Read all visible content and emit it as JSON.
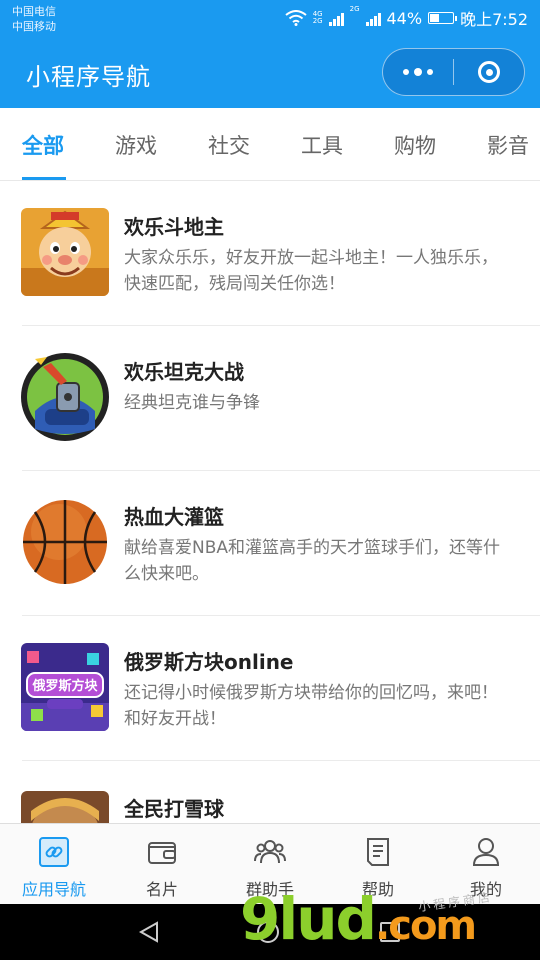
{
  "status_bar": {
    "carrier1": "中国电信",
    "carrier2": "中国移动",
    "net1": "4G",
    "net2": "2G",
    "net3": "2G",
    "battery": "44%",
    "battery_level": 0.44,
    "time": "晚上7:52"
  },
  "header": {
    "title": "小程序导航",
    "background": "#1a9af0"
  },
  "tabs": [
    {
      "label": "全部",
      "active": true
    },
    {
      "label": "游戏"
    },
    {
      "label": "社交"
    },
    {
      "label": "工具"
    },
    {
      "label": "购物"
    },
    {
      "label": "影音"
    }
  ],
  "items": [
    {
      "name": "欢乐斗地主",
      "desc": "大家众乐乐，好友开放一起斗地主！一人独乐乐，快速匹配，残局闯关任你选！",
      "icon": "doudizhu-icon"
    },
    {
      "name": "欢乐坦克大战",
      "desc": "经典坦克谁与争锋",
      "icon": "tank-icon"
    },
    {
      "name": "热血大灌篮",
      "desc": "献给喜爱NBA和灌篮高手的天才篮球手们，还等什么快来吧。",
      "icon": "basketball-icon"
    },
    {
      "name": "俄罗斯方块online",
      "desc": "还记得小时候俄罗斯方块带给你的回忆吗，来吧！和好友开战！",
      "icon": "tetris-icon",
      "icon_text": "俄罗斯方块"
    },
    {
      "name": "全民打雪球",
      "desc": "",
      "icon": "snowball-icon"
    }
  ],
  "tabbar": [
    {
      "label": "应用导航",
      "icon": "link-icon",
      "active": true
    },
    {
      "label": "名片",
      "icon": "wallet-icon"
    },
    {
      "label": "群助手",
      "icon": "group-icon"
    },
    {
      "label": "帮助",
      "icon": "document-icon"
    },
    {
      "label": "我的",
      "icon": "user-icon"
    }
  ],
  "watermark": {
    "main": "9lud",
    "suffix": ".com",
    "small": "小程序商店"
  }
}
